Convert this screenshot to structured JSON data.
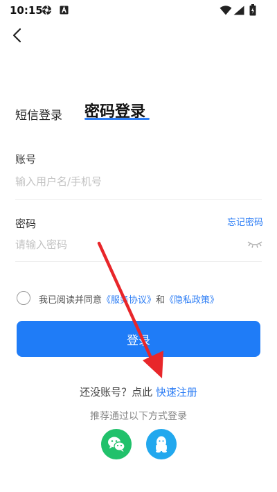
{
  "status_bar": {
    "time": "10:15",
    "icons": [
      "settings-app-icon",
      "notification-a-icon",
      "wifi-icon",
      "signal-icon",
      "battery-icon"
    ]
  },
  "nav": {
    "back_icon": "chevron-left-icon"
  },
  "tabs": {
    "sms_login": "短信登录",
    "password_login": "密码登录",
    "active": "password_login",
    "accent_color": "#2c7df5"
  },
  "form": {
    "account_label": "账号",
    "account_placeholder": "输入用户名/手机号",
    "password_label": "密码",
    "password_placeholder": "请输入密码",
    "forgot_password": "忘记密码",
    "password_visibility_icon": "eye-closed-icon"
  },
  "agreement": {
    "prefix": "我已阅读并同意",
    "service_agreement": "《服务协议》",
    "and": "和",
    "privacy_policy": "《隐私政策》",
    "checked": false
  },
  "login_button": {
    "label": "登录",
    "color": "#1f7cf7"
  },
  "register": {
    "prompt": "还没账号？点此",
    "link": "快速注册"
  },
  "social_login": {
    "hint": "推荐通过以下方式登录",
    "options": [
      {
        "icon": "wechat-icon",
        "color": "#21c16b"
      },
      {
        "icon": "qq-icon",
        "color": "#22a8ee"
      }
    ]
  },
  "annotation": {
    "icon": "red-arrow-icon",
    "color": "#e8262a"
  }
}
